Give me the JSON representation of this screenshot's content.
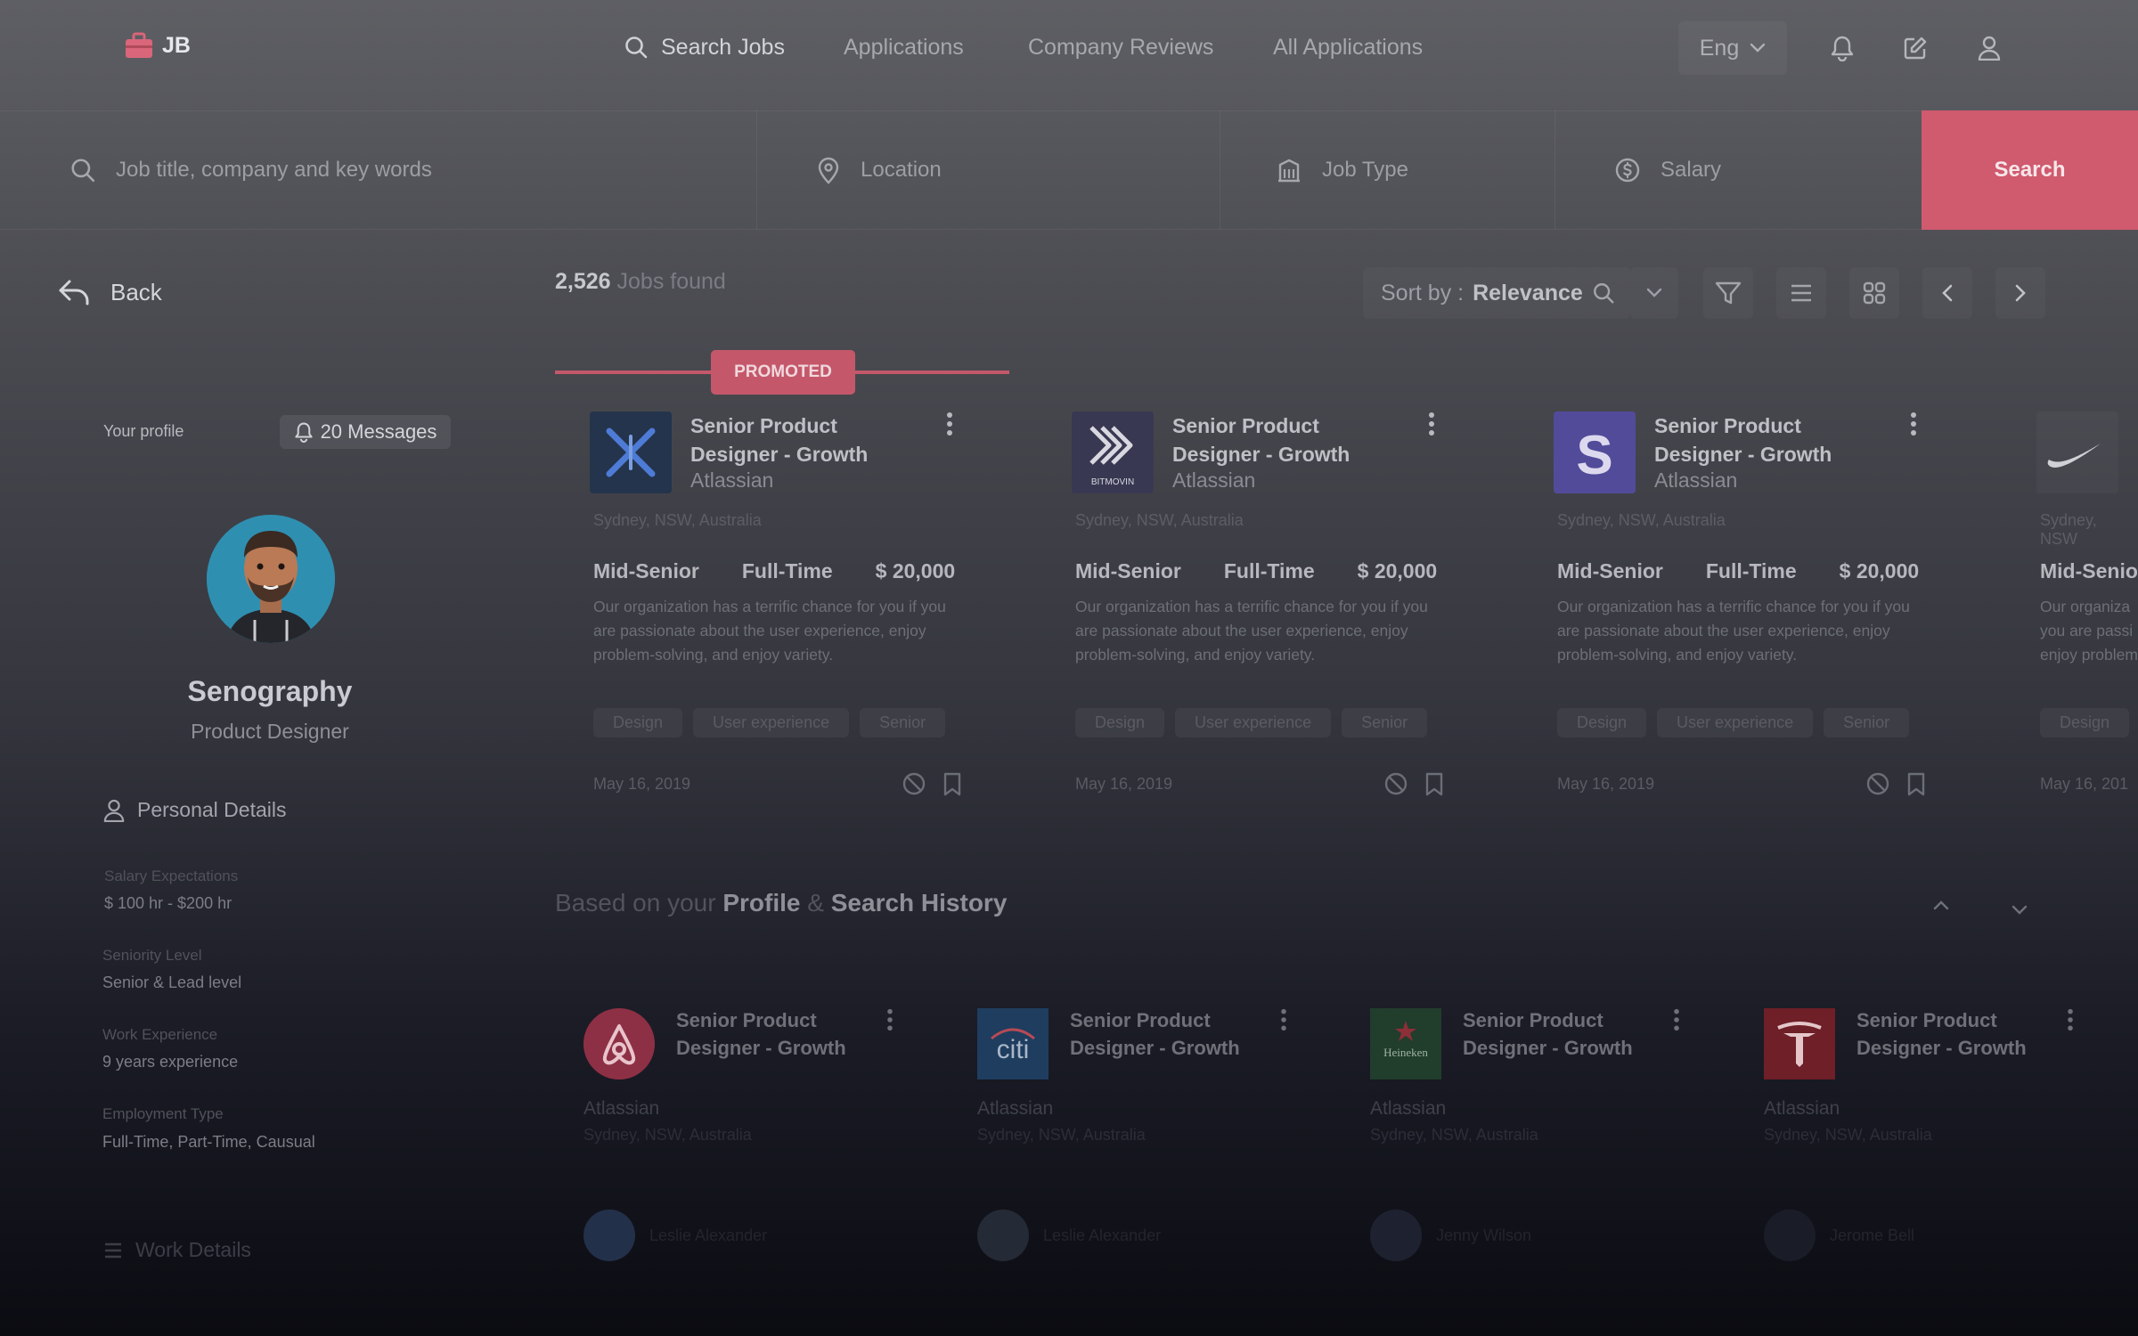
{
  "header": {
    "logo_text": "JB",
    "nav": [
      {
        "label": "Search Jobs",
        "active": true
      },
      {
        "label": "Applications"
      },
      {
        "label": "Company Reviews"
      },
      {
        "label": "All Applications"
      }
    ],
    "language": "Eng",
    "icons": [
      "bell-icon",
      "edit-icon",
      "user-icon"
    ]
  },
  "search": {
    "keywords_placeholder": "Job title, company and key words",
    "location_placeholder": "Location",
    "jobtype_placeholder": "Job Type",
    "salary_placeholder": "Salary",
    "button_label": "Search"
  },
  "sidebar": {
    "back_label": "Back",
    "profile_label": "Your profile",
    "messages_label": "20 Messages",
    "name": "Senography",
    "role": "Product Designer",
    "personal_title": "Personal Details",
    "details": [
      {
        "label": "Salary Expectations",
        "value": "$ 100 hr - $200 hr"
      },
      {
        "label": "Seniority Level",
        "value": "Senior & Lead level"
      },
      {
        "label": "Work Experience",
        "value": "9 years experience"
      },
      {
        "label": "Employment Type",
        "value": "Full-Time, Part-Time, Causual"
      }
    ],
    "work_title": "Work Details"
  },
  "results": {
    "count": "2,526",
    "count_suffix": "Jobs found",
    "sort_prefix": "Sort by :",
    "sort_value": "Relevance",
    "promoted_label": "PROMOTED"
  },
  "jobs": [
    {
      "title": "Senior Product Designer - Growth",
      "company": "Atlassian",
      "location": "Sydney, NSW, Australia",
      "level": "Mid-Senior",
      "type": "Full-Time",
      "salary": "$ 20,000",
      "description": "Our organization has a terrific chance for you if you are passionate about the user experience, enjoy problem-solving, and enjoy variety.",
      "tags": [
        "Design",
        "User experience",
        "Senior"
      ],
      "date": "May 16, 2019",
      "logo": "atlassian-x-logo"
    },
    {
      "title": "Senior Product Designer - Growth",
      "company": "Atlassian",
      "location": "Sydney, NSW, Australia",
      "level": "Mid-Senior",
      "type": "Full-Time",
      "salary": "$ 20,000",
      "description": "Our organization has a terrific chance for you if you are passionate about the user experience, enjoy problem-solving, and enjoy variety.",
      "tags": [
        "Design",
        "User experience",
        "Senior"
      ],
      "date": "May 16, 2019",
      "logo": "bitmovin-logo",
      "logo_text": "BITMOVIN"
    },
    {
      "title": "Senior Product Designer - Growth",
      "company": "Atlassian",
      "location": "Sydney, NSW, Australia",
      "level": "Mid-Senior",
      "type": "Full-Time",
      "salary": "$ 20,000",
      "description": "Our organization has a terrific chance for you if you are passionate about the user experience, enjoy problem-solving, and enjoy variety.",
      "tags": [
        "Design",
        "User experience",
        "Senior"
      ],
      "date": "May 16, 2019",
      "logo": "s-logo",
      "logo_text": "S"
    },
    {
      "title": "",
      "company": "",
      "location": "Sydney, NSW",
      "level": "Mid-Senior",
      "type": "",
      "salary": "",
      "description": "Our organiza you are passi enjoy problem",
      "tags": [
        "Design"
      ],
      "date": "May 16, 201",
      "logo": "nike-logo"
    }
  ],
  "recommended": {
    "title_prefix": "Based on your",
    "title_profile": "Profile",
    "title_amp": "&",
    "title_history": "Search History",
    "cards": [
      {
        "title": "Senior Product Designer - Growth",
        "company": "Atlassian",
        "location": "Sydney, NSW, Australia",
        "person": "Leslie Alexander",
        "logo": "airbnb-logo"
      },
      {
        "title": "Senior Product Designer - Growth",
        "company": "Atlassian",
        "location": "Sydney, NSW, Australia",
        "person": "Leslie Alexander",
        "logo": "citi-logo",
        "logo_text": "citi"
      },
      {
        "title": "Senior Product Designer - Growth",
        "company": "Atlassian",
        "location": "Sydney, NSW, Australia",
        "person": "Jenny Wilson",
        "logo": "heineken-logo",
        "logo_text": "Heineken"
      },
      {
        "title": "Senior Product Designer - Growth",
        "company": "Atlassian",
        "location": "Sydney, NSW, Australia",
        "person": "Jerome Bell",
        "logo": "tesla-logo"
      }
    ]
  },
  "colors": {
    "accent": "#d05a6e",
    "promoted": "#c4586a"
  }
}
